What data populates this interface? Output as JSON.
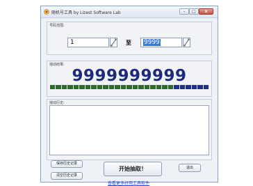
{
  "window": {
    "title": "随机号工具   by Lizest Software Lab",
    "title_buttons": [
      "–",
      "□",
      "x"
    ]
  },
  "range_panel": {
    "label": "号码范围:",
    "from_value": "1",
    "to_label": "至",
    "to_value": "9999"
  },
  "result_panel": {
    "label": "摇动结果:",
    "number": "9999999999",
    "progress_segments": 27,
    "progress_fraction": 1.0,
    "segment_colors": [
      "#2d6a2d",
      "#1e2f8c"
    ]
  },
  "record_panel": {
    "label": "摇动历史:"
  },
  "buttons": {
    "save_records": "保存历史记录",
    "clear_records": "清空历史记录",
    "start_draw": "开始抽取！",
    "exit": "退出"
  },
  "footer": {
    "more_tools_link": "查看更多好用工具软件"
  },
  "colors": {
    "result_text": "#1f2a7a",
    "link": "#1a3fd6",
    "close_button": "#c9543f"
  },
  "icons": {
    "app": "app-icon",
    "spin": "spin-arrows-icon"
  }
}
